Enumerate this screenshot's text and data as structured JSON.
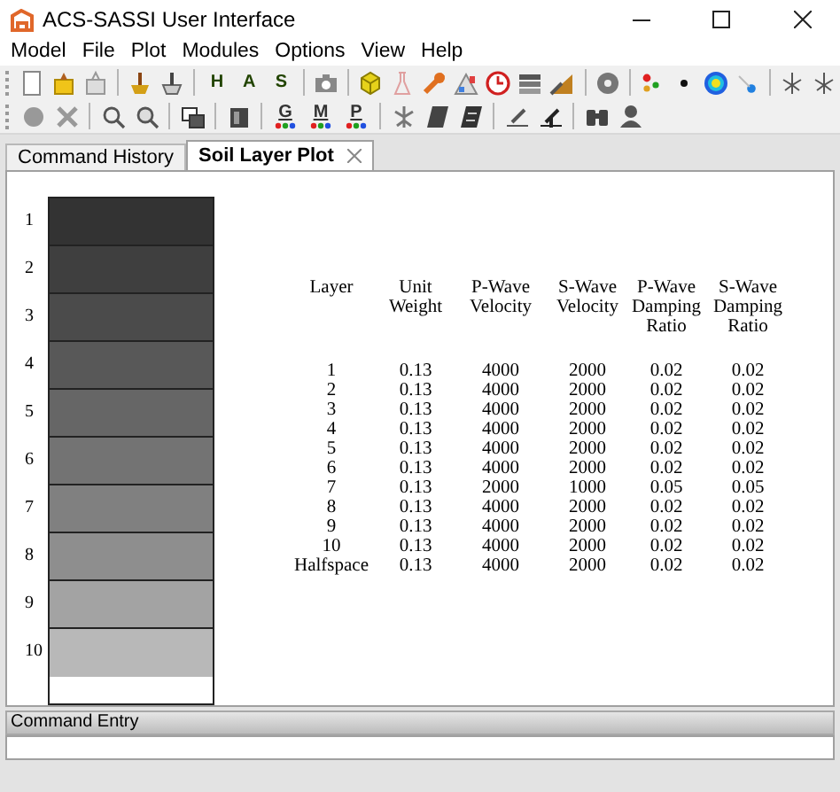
{
  "window": {
    "title": "ACS-SASSI User Interface"
  },
  "menu": [
    "Model",
    "File",
    "Plot",
    "Modules",
    "Options",
    "View",
    "Help"
  ],
  "toolbars": [
    [
      {
        "kind": "icon"
      },
      {
        "kind": "icon"
      },
      {
        "kind": "icon"
      },
      {
        "kind": "sep"
      },
      {
        "kind": "icon"
      },
      {
        "kind": "icon"
      },
      {
        "kind": "sep"
      },
      {
        "kind": "letter",
        "text": "H"
      },
      {
        "kind": "letter",
        "text": "A"
      },
      {
        "kind": "letter",
        "text": "S"
      },
      {
        "kind": "sep"
      },
      {
        "kind": "icon"
      },
      {
        "kind": "sep"
      },
      {
        "kind": "icon"
      },
      {
        "kind": "icon"
      },
      {
        "kind": "icon"
      },
      {
        "kind": "icon"
      },
      {
        "kind": "icon"
      },
      {
        "kind": "icon"
      },
      {
        "kind": "icon"
      },
      {
        "kind": "sep"
      },
      {
        "kind": "icon"
      },
      {
        "kind": "sep"
      },
      {
        "kind": "icon"
      },
      {
        "kind": "icon"
      },
      {
        "kind": "icon"
      },
      {
        "kind": "icon"
      },
      {
        "kind": "sep"
      },
      {
        "kind": "icon"
      },
      {
        "kind": "icon"
      }
    ],
    [
      {
        "kind": "icon"
      },
      {
        "kind": "icon"
      },
      {
        "kind": "sep"
      },
      {
        "kind": "icon"
      },
      {
        "kind": "icon"
      },
      {
        "kind": "sep"
      },
      {
        "kind": "icon"
      },
      {
        "kind": "sep"
      },
      {
        "kind": "icon"
      },
      {
        "kind": "sep"
      },
      {
        "kind": "dotted",
        "text": "G"
      },
      {
        "kind": "dotted",
        "text": "M"
      },
      {
        "kind": "dotted",
        "text": "P"
      },
      {
        "kind": "sep"
      },
      {
        "kind": "icon"
      },
      {
        "kind": "icon"
      },
      {
        "kind": "icon"
      },
      {
        "kind": "sep"
      },
      {
        "kind": "icon"
      },
      {
        "kind": "icon"
      },
      {
        "kind": "sep"
      },
      {
        "kind": "icon"
      },
      {
        "kind": "icon"
      }
    ]
  ],
  "tabs": [
    {
      "label": "Command History",
      "selected": false
    },
    {
      "label": "Soil Layer Plot",
      "selected": true
    }
  ],
  "soil_column": [
    {
      "label": "1",
      "color": "#333333"
    },
    {
      "label": "2",
      "color": "#3f3f3f"
    },
    {
      "label": "3",
      "color": "#4b4b4b"
    },
    {
      "label": "4",
      "color": "#585858"
    },
    {
      "label": "5",
      "color": "#666666"
    },
    {
      "label": "6",
      "color": "#737373"
    },
    {
      "label": "7",
      "color": "#808080"
    },
    {
      "label": "8",
      "color": "#8e8e8e"
    },
    {
      "label": "9",
      "color": "#a3a3a3"
    },
    {
      "label": "10",
      "color": "#b8b8b8"
    }
  ],
  "table": {
    "columns": [
      "Layer",
      "Unit Weight",
      "P-Wave Velocity",
      "S-Wave Velocity",
      "P-Wave Damping Ratio",
      "S-Wave Damping Ratio"
    ],
    "rows": [
      [
        "1",
        "0.13",
        "4000",
        "2000",
        "0.02",
        "0.02"
      ],
      [
        "2",
        "0.13",
        "4000",
        "2000",
        "0.02",
        "0.02"
      ],
      [
        "3",
        "0.13",
        "4000",
        "2000",
        "0.02",
        "0.02"
      ],
      [
        "4",
        "0.13",
        "4000",
        "2000",
        "0.02",
        "0.02"
      ],
      [
        "5",
        "0.13",
        "4000",
        "2000",
        "0.02",
        "0.02"
      ],
      [
        "6",
        "0.13",
        "4000",
        "2000",
        "0.02",
        "0.02"
      ],
      [
        "7",
        "0.13",
        "2000",
        "1000",
        "0.05",
        "0.05"
      ],
      [
        "8",
        "0.13",
        "4000",
        "2000",
        "0.02",
        "0.02"
      ],
      [
        "9",
        "0.13",
        "4000",
        "2000",
        "0.02",
        "0.02"
      ],
      [
        "10",
        "0.13",
        "4000",
        "2000",
        "0.02",
        "0.02"
      ],
      [
        "Halfspace",
        "0.13",
        "4000",
        "2000",
        "0.02",
        "0.02"
      ]
    ]
  },
  "command_entry": {
    "label": "Command Entry"
  }
}
